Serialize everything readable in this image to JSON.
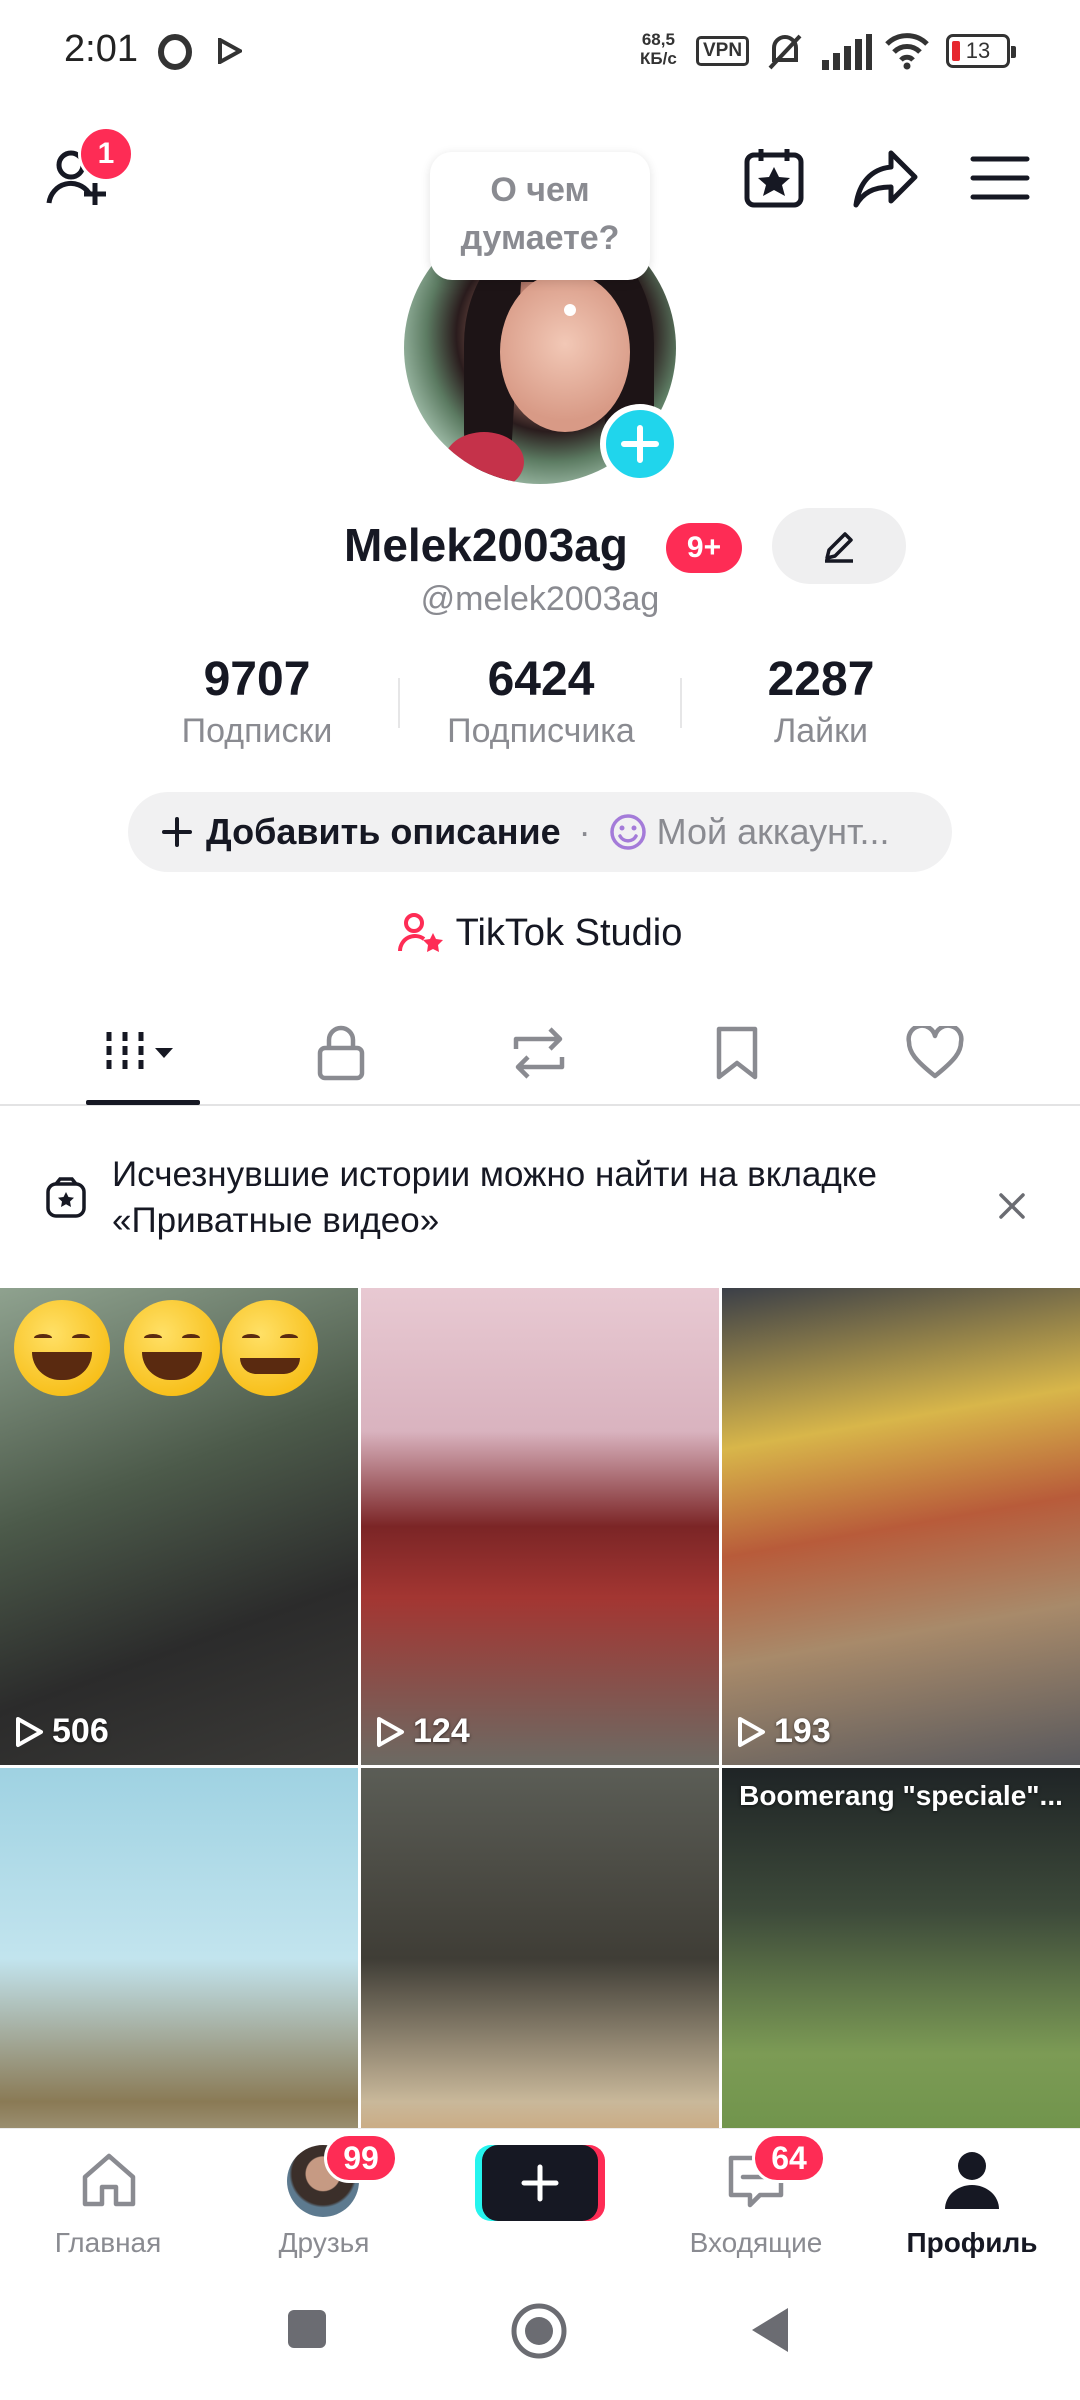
{
  "status_bar": {
    "time": "2:01",
    "net_speed_value": "68,5",
    "net_speed_unit": "КБ/с",
    "vpn": "VPN",
    "battery": "13"
  },
  "header": {
    "friends_badge": "1",
    "icons": [
      "add-friend-icon",
      "calendar-star-icon",
      "share-icon",
      "menu-icon"
    ]
  },
  "profile": {
    "thought_bubble": "О чем думаете?",
    "username": "Melek2003ag",
    "username_badge": "9+",
    "handle": "@melek2003ag",
    "stats": [
      {
        "value": "9707",
        "label": "Подписки"
      },
      {
        "value": "6424",
        "label": "Подписчика"
      },
      {
        "value": "2287",
        "label": "Лайки"
      }
    ],
    "add_bio": "Добавить описание",
    "bio_separator": "·",
    "my_account": "Мой аккаунт...",
    "studio": "TikTok Studio"
  },
  "tabs": [
    "videos-grid",
    "private",
    "reposts",
    "favorites",
    "liked"
  ],
  "notice": {
    "text": "Исчезнувшие истории можно найти на вкладке «Приватные видео»"
  },
  "videos": [
    {
      "views": "506",
      "caption": ""
    },
    {
      "views": "124",
      "caption": ""
    },
    {
      "views": "193",
      "caption": ""
    },
    {
      "views": "",
      "caption": ""
    },
    {
      "views": "",
      "caption": ""
    },
    {
      "views": "",
      "caption": "Boomerang \"speciale\"..."
    }
  ],
  "bottom_nav": {
    "home": "Главная",
    "friends": "Друзья",
    "friends_badge": "99",
    "inbox": "Входящие",
    "inbox_badge": "64",
    "profile": "Профиль"
  },
  "colors": {
    "accent_red": "#fe2c55",
    "accent_cyan": "#20d5ec",
    "text_primary": "#161823",
    "text_secondary": "#8a8b91"
  }
}
